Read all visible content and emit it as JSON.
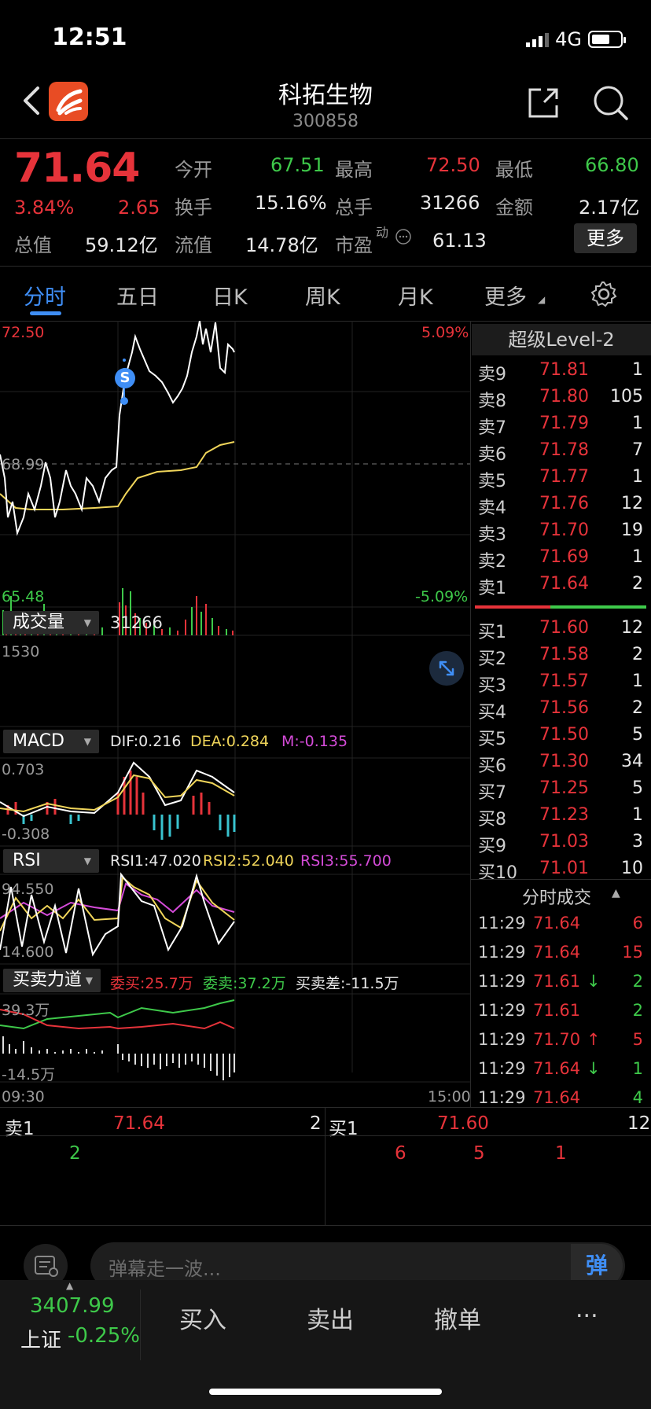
{
  "status_bar": {
    "time": "12:51",
    "network": "4G"
  },
  "nav": {
    "title": "科拓生物",
    "code": "300858"
  },
  "quote": {
    "price": "71.64",
    "change_pct": "3.84%",
    "change": "2.65",
    "open_label": "今开",
    "open": "67.51",
    "high_label": "最高",
    "high": "72.50",
    "low_label": "最低",
    "low": "66.80",
    "turnover_label": "换手",
    "turnover": "15.16%",
    "volume_label": "总手",
    "volume": "31266",
    "amount_label": "金额",
    "amount": "2.17亿",
    "total_cap_label": "总值",
    "total_cap": "59.12亿",
    "float_cap_label": "流值",
    "float_cap": "14.78亿",
    "pe_label": "市盈",
    "pe_super": "动",
    "pe": "61.13",
    "more_label": "更多"
  },
  "tabs": [
    "分时",
    "五日",
    "日K",
    "周K",
    "月K",
    "更多"
  ],
  "main_chart": {
    "top_price": "72.50",
    "mid_price": "68.99",
    "bottom_price": "65.48",
    "top_pct": "5.09%",
    "bottom_pct": "-5.09%",
    "marker": "S"
  },
  "volume_panel": {
    "label": "成交量",
    "value": "31266",
    "scale": "1530"
  },
  "macd_panel": {
    "label": "MACD",
    "dif": "DIF:0.216",
    "dea": "DEA:0.284",
    "m": "M:-0.135",
    "top": "0.703",
    "bottom": "-0.308"
  },
  "rsi_panel": {
    "label": "RSI",
    "rsi1": "RSI1:47.020",
    "rsi2": "RSI2:52.040",
    "rsi3": "RSI3:55.700",
    "top": "94.550",
    "bottom": "14.600"
  },
  "force_panel": {
    "label": "买卖力道",
    "buy": "委买:25.7万",
    "sell": "委卖:37.2万",
    "diff": "买卖差:-11.5万",
    "top": "39.3万",
    "bottom": "-14.5万"
  },
  "time_axis": {
    "start": "09:30",
    "end": "15:00"
  },
  "order_book": {
    "title": "超级Level-2",
    "asks": [
      {
        "label": "卖9",
        "price": "71.81",
        "vol": "1"
      },
      {
        "label": "卖8",
        "price": "71.80",
        "vol": "105"
      },
      {
        "label": "卖7",
        "price": "71.79",
        "vol": "1"
      },
      {
        "label": "卖6",
        "price": "71.78",
        "vol": "7"
      },
      {
        "label": "卖5",
        "price": "71.77",
        "vol": "1"
      },
      {
        "label": "卖4",
        "price": "71.76",
        "vol": "12"
      },
      {
        "label": "卖3",
        "price": "71.70",
        "vol": "19"
      },
      {
        "label": "卖2",
        "price": "71.69",
        "vol": "1"
      },
      {
        "label": "卖1",
        "price": "71.64",
        "vol": "2"
      }
    ],
    "bids": [
      {
        "label": "买1",
        "price": "71.60",
        "vol": "12"
      },
      {
        "label": "买2",
        "price": "71.58",
        "vol": "2"
      },
      {
        "label": "买3",
        "price": "71.57",
        "vol": "1"
      },
      {
        "label": "买4",
        "price": "71.56",
        "vol": "2"
      },
      {
        "label": "买5",
        "price": "71.50",
        "vol": "5"
      },
      {
        "label": "买6",
        "price": "71.30",
        "vol": "34"
      },
      {
        "label": "买7",
        "price": "71.25",
        "vol": "5"
      },
      {
        "label": "买8",
        "price": "71.23",
        "vol": "1"
      },
      {
        "label": "买9",
        "price": "71.03",
        "vol": "3"
      },
      {
        "label": "买10",
        "price": "71.01",
        "vol": "10"
      }
    ]
  },
  "trades": {
    "title": "分时成交",
    "rows": [
      {
        "time": "11:29",
        "price": "71.64",
        "vol": "6",
        "dir": "",
        "color": "red"
      },
      {
        "time": "11:29",
        "price": "71.64",
        "vol": "15",
        "dir": "",
        "color": "red"
      },
      {
        "time": "11:29",
        "price": "71.61",
        "vol": "2",
        "dir": "↓",
        "color": "green"
      },
      {
        "time": "11:29",
        "price": "71.61",
        "vol": "2",
        "dir": "",
        "color": "green"
      },
      {
        "time": "11:29",
        "price": "71.70",
        "vol": "5",
        "dir": "↑",
        "color": "red"
      },
      {
        "time": "11:29",
        "price": "71.64",
        "vol": "1",
        "dir": "↓",
        "color": "green"
      },
      {
        "time": "11:29",
        "price": "71.64",
        "vol": "4",
        "dir": "",
        "color": "green"
      }
    ]
  },
  "bid_ask_bar": {
    "ask_label": "卖1",
    "ask_price": "71.64",
    "ask_vol": "2",
    "bid_label": "买1",
    "bid_price": "71.60",
    "bid_vol": "12",
    "ask_queue": [
      "2"
    ],
    "bid_queue": [
      "6",
      "5",
      "1"
    ]
  },
  "danmu": {
    "placeholder": "弹幕走一波...",
    "button": "弹"
  },
  "bottom": {
    "index_value": "3407.99",
    "index_name": "上证",
    "index_change": "-0.25%",
    "buy": "买入",
    "sell": "卖出",
    "cancel": "撤单",
    "more": "..."
  },
  "colors": {
    "up": "#e6333a",
    "down": "#3ec94a",
    "accent": "#3f8ef5",
    "avg_line": "#f0d55a"
  }
}
